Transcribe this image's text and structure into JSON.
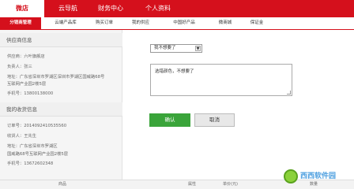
{
  "top_nav": {
    "tabs": [
      "微店",
      "云导航",
      "财务中心",
      "个人资料"
    ]
  },
  "sub_nav": {
    "items": [
      "分销商管理",
      "云端产品库",
      "购买订单",
      "我的供应",
      "中国好产品",
      "微商城",
      "保证金"
    ]
  },
  "supplier": {
    "title": "供应商信息",
    "name": "供应商：六叶旗舰店",
    "contact": "负责人：张三",
    "address_line1": "地址：广东省深圳市罗湖区深圳市罗湖区国威路68号",
    "address_line2": "互联网产业园2楼5层",
    "phone": "手机号：13800138000"
  },
  "receiver": {
    "title": "我的收货信息",
    "order_no": "订单号：2014092410535560",
    "name": "收货人：王先生",
    "address_line1": "地址：广东省深圳市罗湖区",
    "address_line2": "国威路68号互联网产业园2楼5层",
    "phone": "手机号：13672602348"
  },
  "form": {
    "select_value": "我不想要了",
    "textarea_value": "选错颜色，不想要了",
    "confirm_label": "确认",
    "cancel_label": "取消"
  },
  "table_header": [
    "商品",
    "属性",
    "单价(元)",
    "数量"
  ],
  "watermark": {
    "text": "西西软件园"
  }
}
